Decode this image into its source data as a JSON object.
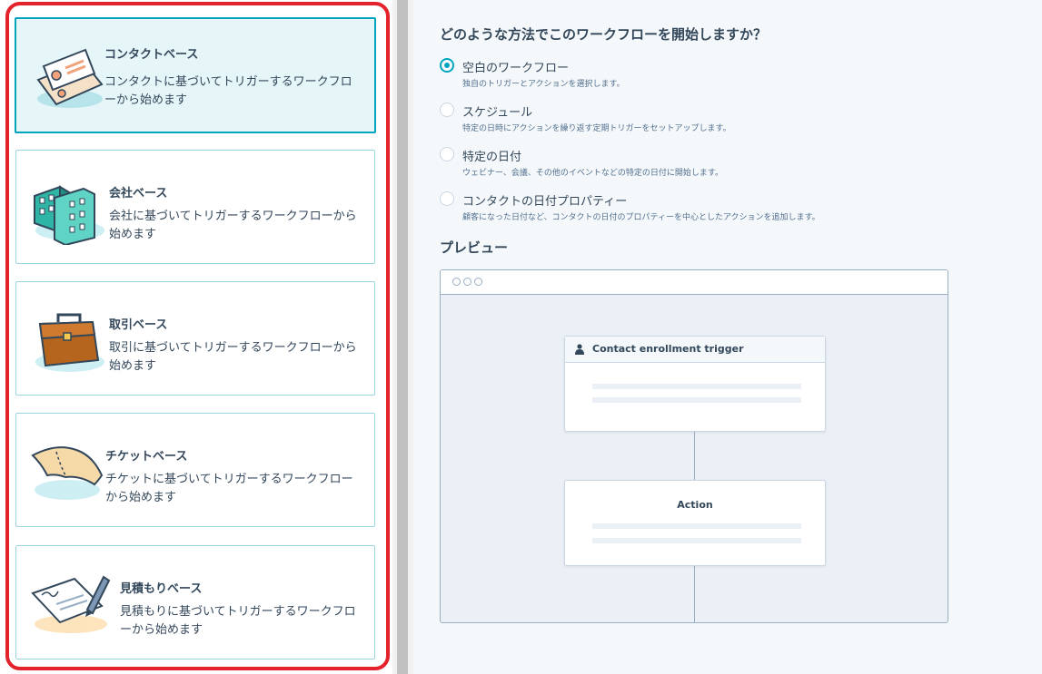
{
  "cards": [
    {
      "title": "コンタクトベース",
      "desc_line1": "コンタクトに基づいてトリガーするワークフロ",
      "desc_line2": "ーから始めます",
      "illustration": "contact-card-icon",
      "selected": true
    },
    {
      "title": "会社ベース",
      "desc_line1": "会社に基づいてトリガーするワークフローから",
      "desc_line2": "始めます",
      "illustration": "company-building-icon",
      "selected": false
    },
    {
      "title": "取引ベース",
      "desc_line1": "取引に基づいてトリガーするワークフローから",
      "desc_line2": "始めます",
      "illustration": "briefcase-icon",
      "selected": false
    },
    {
      "title": "チケットベース",
      "desc_line1": "チケットに基づいてトリガーするワークフロー",
      "desc_line2": "から始めます",
      "illustration": "ticket-icon",
      "selected": false
    },
    {
      "title": "見積もりベース",
      "desc_line1": "見積もりに基づいてトリガーするワークフロ",
      "desc_line2": "ーから始めます",
      "illustration": "quote-signature-icon",
      "selected": false
    }
  ],
  "question": "どのような方法でこのワークフローを開始しますか？",
  "options": [
    {
      "label": "空白のワークフロー",
      "help": "独自のトリガーとアクションを選択します。",
      "checked": true
    },
    {
      "label": "スケジュール",
      "help": "特定の日時にアクションを繰り返す定期トリガーをセットアップします。",
      "checked": false
    },
    {
      "label": "特定の日付",
      "help": "ウェビナー、会議、その他のイベントなどの特定の日付に開始します。",
      "checked": false
    },
    {
      "label": "コンタクトの日付プロパティー",
      "help": "顧客になった日付など、コンタクトの日付のプロパティーを中心としたアクションを追加します。",
      "checked": false
    }
  ],
  "preview": {
    "title": "プレビュー",
    "trigger_label": "Contact enrollment trigger",
    "action_label": "Action"
  },
  "colors": {
    "accent": "#00a4bd",
    "highlight": "#e4222b",
    "text": "#33475b"
  }
}
